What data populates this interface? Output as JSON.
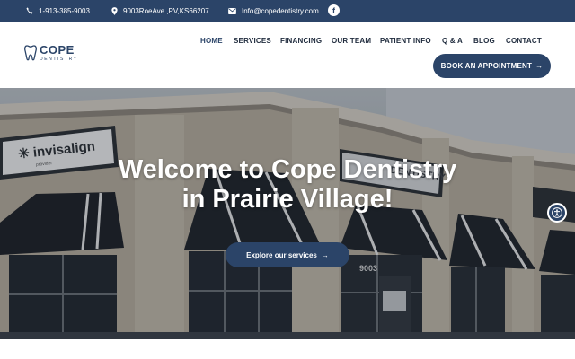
{
  "topbar": {
    "phone": "1-913-385-9003",
    "address": "9003RoeAve.,PV,KS66207",
    "email": "Info@copedentistry.com",
    "facebook_icon": "facebook-icon"
  },
  "logo": {
    "name": "COPE",
    "sub": "DENTISTRY",
    "icon": "tooth-icon"
  },
  "nav": {
    "items": [
      "HOME",
      "SERVICES",
      "FINANCING",
      "OUR TEAM",
      "PATIENT INFO",
      "Q & A",
      "BLOG",
      "CONTACT"
    ],
    "active": "HOME"
  },
  "header": {
    "cta_label": "BOOK AN APPOINTMENT",
    "cta_arrow": "→"
  },
  "hero": {
    "title_line1": "Welcome to Cope Dentistry",
    "title_line2": "in Prairie Village!",
    "button_label": "Explore our services",
    "button_arrow": "→",
    "sign_invisalign": "invisalign",
    "sign_invisalign_sub": "provider",
    "sign_building": "DENTISTRY",
    "address_number": "9003"
  },
  "colors": {
    "brand": "#2b4468",
    "white": "#ffffff"
  }
}
